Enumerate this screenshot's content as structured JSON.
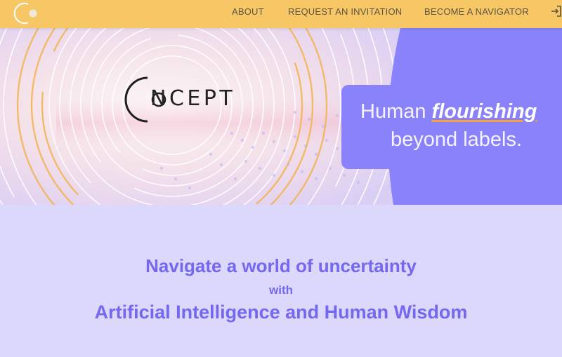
{
  "nav": {
    "links": [
      "ABOUT",
      "REQUEST AN INVITATION",
      "BECOME A NAVIGATOR"
    ],
    "login_icon": "login-icon",
    "logo_icon": "concept-logo-icon"
  },
  "hero": {
    "brand": "NCEPT",
    "brand_icon": "concept-c-mark-icon",
    "tagline": {
      "line1_prefix": "Human ",
      "line1_emphasis": "flourishing",
      "line2": "beyond labels."
    }
  },
  "intro": {
    "line1": "Navigate a world of uncertainty",
    "line2": "with",
    "line3": "Artificial Intelligence and Human Wisdom"
  },
  "colors": {
    "nav_background": "#f8c765",
    "accent_purple": "#8a82fb",
    "headline_purple": "#7467f0",
    "lower_background": "#dcd8fb"
  }
}
